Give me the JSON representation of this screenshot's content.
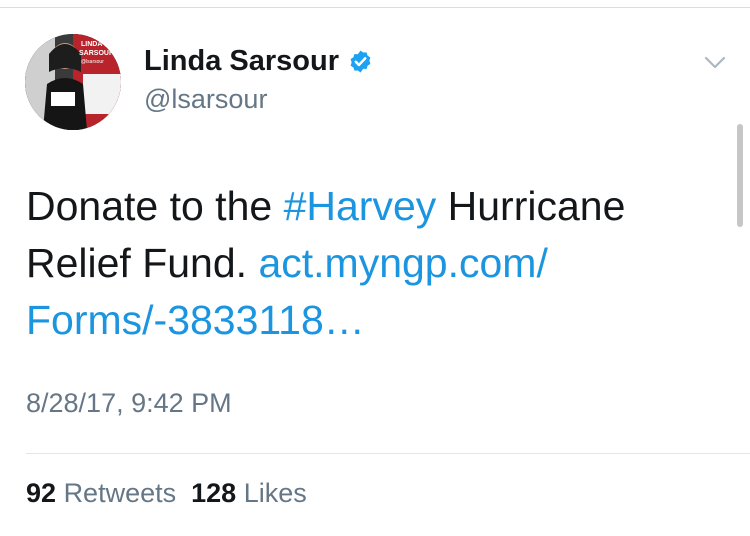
{
  "tweet": {
    "author_name": "Linda Sarsour",
    "handle": "@lsarsour",
    "text_before": "Donate to the ",
    "hashtag": "#Harvey",
    "text_middle": " Hurricane Relief Fund. ",
    "link_text": "act.myngp.com/​Forms/-3833118…",
    "timestamp": "8/28/17, 9:42 PM",
    "retweet_count": "92",
    "retweet_label": "Retweets",
    "like_count": "128",
    "like_label": "Likes"
  },
  "avatar": {
    "badge_line1": "LINDA",
    "badge_line2": "SARSOUR",
    "badge_line3": "@lsarsour"
  },
  "icons": {
    "verified": "verified-badge-icon",
    "menu": "chevron-down-icon"
  },
  "colors": {
    "link": "#1b95e0",
    "verified": "#1da1f2",
    "secondary_text": "#657786",
    "primary_text": "#14171a"
  }
}
